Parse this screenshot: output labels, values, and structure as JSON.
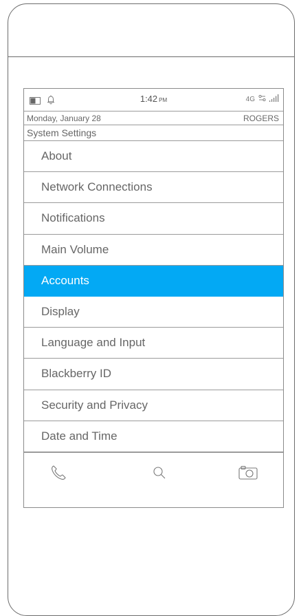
{
  "status": {
    "time": "1:42",
    "ampm": "PM",
    "network": "4G",
    "battery_icon": "battery-icon",
    "notification_icon": "bell-icon",
    "signal_icon": "signal-icon"
  },
  "datebar": {
    "date": "Monday, January 28",
    "carrier": "ROGERS"
  },
  "page_title": "System Settings",
  "menu": {
    "items": [
      {
        "label": "About"
      },
      {
        "label": "Network Connections"
      },
      {
        "label": "Notifications"
      },
      {
        "label": "Main Volume"
      },
      {
        "label": "Accounts",
        "active": true
      },
      {
        "label": "Display"
      },
      {
        "label": "Language and Input"
      },
      {
        "label": "Blackberry ID"
      },
      {
        "label": "Security and Privacy"
      },
      {
        "label": "Date and Time"
      }
    ]
  },
  "bottom_bar": {
    "buttons": [
      "phone-icon",
      "search-icon",
      "camera-icon"
    ]
  },
  "colors": {
    "accent": "#03a9f4",
    "line": "#9a9a9a",
    "text": "#666666"
  }
}
